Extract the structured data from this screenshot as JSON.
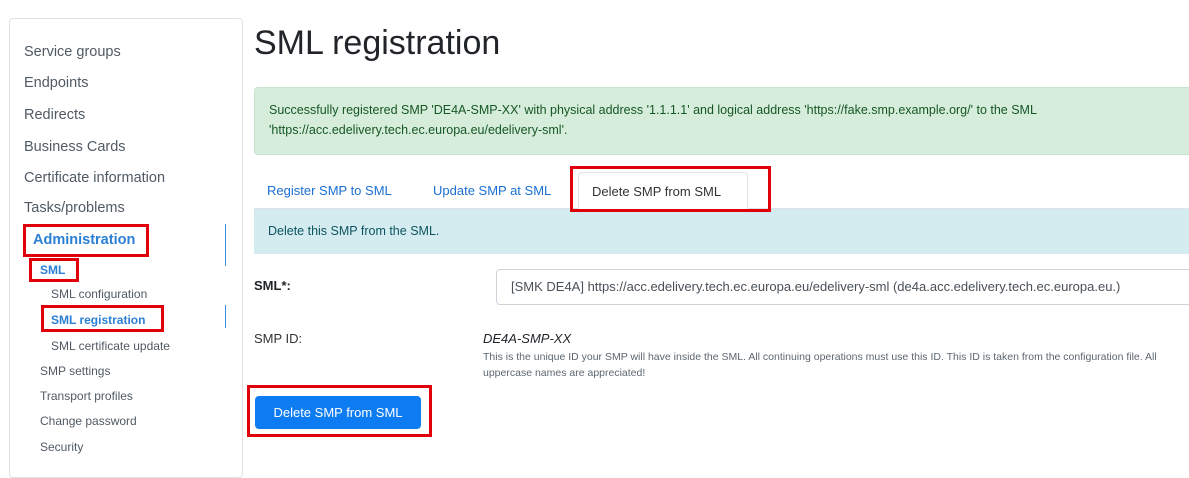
{
  "sidebar": {
    "items": [
      {
        "label": "Service groups"
      },
      {
        "label": "Endpoints"
      },
      {
        "label": "Redirects"
      },
      {
        "label": "Business Cards"
      },
      {
        "label": "Certificate information"
      },
      {
        "label": "Tasks/problems"
      }
    ],
    "admin": {
      "label": "Administration",
      "sml": {
        "label": "SML",
        "children": [
          {
            "label": "SML configuration"
          },
          {
            "label": "SML registration"
          },
          {
            "label": "SML certificate update"
          }
        ]
      },
      "items": [
        {
          "label": "SMP settings"
        },
        {
          "label": "Transport profiles"
        },
        {
          "label": "Change password"
        },
        {
          "label": "Security"
        }
      ]
    }
  },
  "main": {
    "title": "SML registration",
    "success_message": "Successfully registered SMP 'DE4A-SMP-XX' with physical address '1.1.1.1' and logical address 'https://fake.smp.example.org/' to the SML 'https://acc.edelivery.tech.ec.europa.eu/edelivery-sml'.",
    "tabs": [
      {
        "label": "Register SMP to SML"
      },
      {
        "label": "Update SMP at SML"
      },
      {
        "label": "Delete SMP from SML"
      }
    ],
    "info_message": "Delete this SMP from the SML.",
    "form": {
      "sml_label": "SML*:",
      "sml_value": "[SMK DE4A] https://acc.edelivery.tech.ec.europa.eu/edelivery-sml (de4a.acc.edelivery.tech.ec.europa.eu.)",
      "smp_id_label": "SMP ID:",
      "smp_id_value": "DE4A-SMP-XX",
      "smp_id_help": "This is the unique ID your SMP will have inside the SML. All continuing operations must use this ID. This ID is taken from the configuration file. All uppercase names are appreciated!",
      "submit_label": "Delete SMP from SML"
    }
  },
  "colors": {
    "accent": "#0d7cf2",
    "highlight": "#e0000a",
    "success_bg": "#d7eddc",
    "info_bg": "#d4ecf0"
  }
}
